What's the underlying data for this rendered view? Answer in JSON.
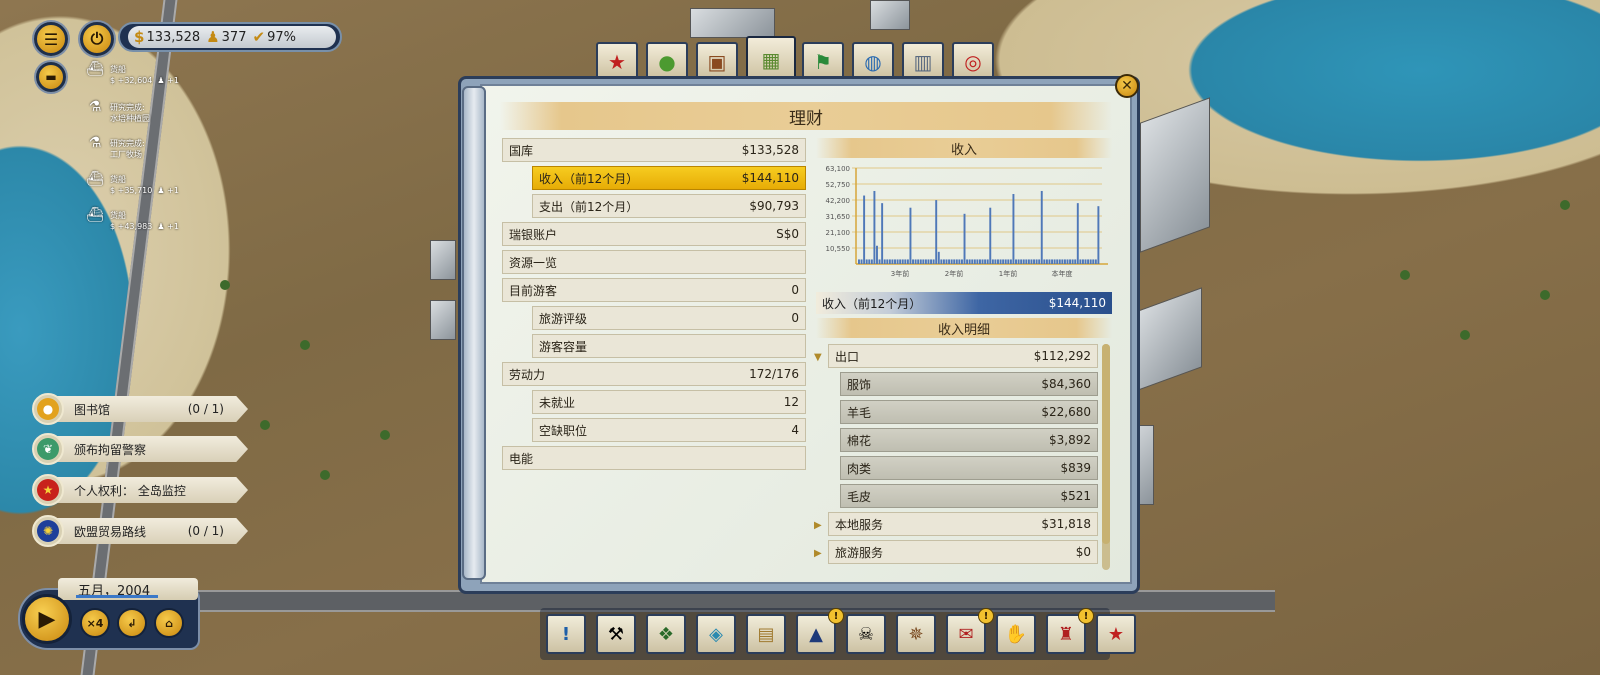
{
  "hud": {
    "menu_icon": "hamburger-menu-icon",
    "power_icon": "power-icon",
    "money": "133,528",
    "population": "377",
    "approval": "97%"
  },
  "notifications": [
    {
      "icon": "ship-icon",
      "line1": "货船",
      "line2": "+32,604",
      "extra": "+1"
    },
    {
      "icon": "flask-icon",
      "line1": "研究完成:",
      "line2": "水培种植园"
    },
    {
      "icon": "flask-icon",
      "line1": "研究完成:",
      "line2": "工厂牧场"
    },
    {
      "icon": "ship-icon",
      "line1": "货船",
      "line2": "+35,710",
      "extra": "+1"
    },
    {
      "icon": "ship-icon",
      "line1": "货船",
      "line2": "+43,983",
      "extra": "+1"
    }
  ],
  "actions": [
    {
      "label": "图书馆",
      "count": "(0 / 1)",
      "color": "#e2a21e"
    },
    {
      "label": "颁布拘留警察",
      "count": "",
      "color": "#3c9a6a"
    },
    {
      "label": "个人权利： 全岛监控",
      "count": "",
      "color": "#c8221c"
    },
    {
      "label": "欧盟贸易路线",
      "count": "(0 / 1)",
      "color": "#1d3f9a"
    }
  ],
  "time": {
    "date": "五月，2004",
    "speed_label": "×4"
  },
  "panel": {
    "title": "理财",
    "left_rows": [
      {
        "label": "国库",
        "value": "$133,528",
        "level": 1
      },
      {
        "label": "收入（前12个月）",
        "value": "$144,110",
        "level": 2,
        "highlight": true
      },
      {
        "label": "支出（前12个月）",
        "value": "$90,793",
        "level": 2
      },
      {
        "label": "瑞银账户",
        "value": "S$0",
        "level": 1
      },
      {
        "label": "资源一览",
        "value": "",
        "level": 1
      },
      {
        "label": "目前游客",
        "value": "0",
        "level": 1
      },
      {
        "label": "旅游评级",
        "value": "0",
        "level": 2
      },
      {
        "label": "游客容量",
        "value": "",
        "level": 2
      },
      {
        "label": "劳动力",
        "value": "172/176",
        "level": 1
      },
      {
        "label": "未就业",
        "value": "12",
        "level": 2
      },
      {
        "label": "空缺职位",
        "value": "4",
        "level": 2
      },
      {
        "label": "电能",
        "value": "",
        "level": 1
      }
    ],
    "income_header": "收入",
    "income_total_label": "收入（前12个月）",
    "income_total_value": "$144,110",
    "breakdown_header": "收入明细",
    "breakdown": [
      {
        "label": "出口",
        "value": "$112,292",
        "level": 1,
        "expanded": true
      },
      {
        "label": "服饰",
        "value": "$84,360",
        "level": 2
      },
      {
        "label": "羊毛",
        "value": "$22,680",
        "level": 2
      },
      {
        "label": "棉花",
        "value": "$3,892",
        "level": 2
      },
      {
        "label": "肉类",
        "value": "$839",
        "level": 2
      },
      {
        "label": "毛皮",
        "value": "$521",
        "level": 2
      },
      {
        "label": "本地服务",
        "value": "$31,818",
        "level": 1,
        "expanded": false
      },
      {
        "label": "旅游服务",
        "value": "$0",
        "level": 1,
        "expanded": false
      }
    ]
  },
  "chart_data": {
    "type": "bar",
    "title": "收入",
    "yticks": [
      "63,100",
      "52,750",
      "42,200",
      "31,650",
      "21,100",
      "10,550"
    ],
    "xticks": [
      "3年前",
      "2年前",
      "1年前",
      "本年度"
    ],
    "ylim": [
      0,
      63100
    ],
    "values": [
      3000,
      3000,
      45000,
      3000,
      3000,
      3000,
      48000,
      12000,
      3000,
      40000,
      3000,
      3000,
      3000,
      3000,
      3000,
      3000,
      3000,
      3000,
      3000,
      3000,
      37000,
      3000,
      3000,
      3000,
      3000,
      3000,
      3000,
      3000,
      3000,
      3000,
      42000,
      8000,
      3000,
      3000,
      3000,
      3000,
      3000,
      3000,
      3000,
      3000,
      3000,
      33000,
      3000,
      3000,
      3000,
      3000,
      3000,
      3000,
      3000,
      3000,
      3000,
      37000,
      3000,
      3000,
      3000,
      3000,
      3000,
      3000,
      3000,
      3000,
      46000,
      3000,
      3000,
      3000,
      3000,
      3000,
      3000,
      3000,
      3000,
      3000,
      3000,
      48000,
      3000,
      3000,
      3000,
      3000,
      3000,
      3000,
      3000,
      3000,
      3000,
      3000,
      3000,
      3000,
      3000,
      40000,
      3000,
      3000,
      3000,
      3000,
      3000,
      3000,
      3000,
      38000
    ],
    "bar_color": "#4f78b8"
  },
  "tabs": [
    {
      "icon": "star-badge-icon"
    },
    {
      "icon": "thumbs-up-icon"
    },
    {
      "icon": "portrait-icon"
    },
    {
      "icon": "money-stack-icon",
      "active": true
    },
    {
      "icon": "flag-icon"
    },
    {
      "icon": "globe-icon"
    },
    {
      "icon": "buildings-icon"
    },
    {
      "icon": "target-icon"
    }
  ],
  "toolbar": [
    {
      "icon": "info-icon",
      "glyph": "!"
    },
    {
      "icon": "hammer-icon",
      "glyph": "⚒"
    },
    {
      "icon": "book-icon",
      "glyph": "❖"
    },
    {
      "icon": "map-icon",
      "glyph": "◈"
    },
    {
      "icon": "scroll-icon",
      "glyph": "▤"
    },
    {
      "icon": "graduation-cap-icon",
      "glyph": "▲",
      "alert": true
    },
    {
      "icon": "pirate-flag-icon",
      "glyph": "☠"
    },
    {
      "icon": "ship-wheel-icon",
      "glyph": "✵"
    },
    {
      "icon": "letter-seal-icon",
      "glyph": "✉",
      "alert": true
    },
    {
      "icon": "handshake-icon",
      "glyph": "✋"
    },
    {
      "icon": "suit-icon",
      "glyph": "♜",
      "alert": true
    },
    {
      "icon": "star-badge-icon",
      "glyph": "★"
    }
  ]
}
